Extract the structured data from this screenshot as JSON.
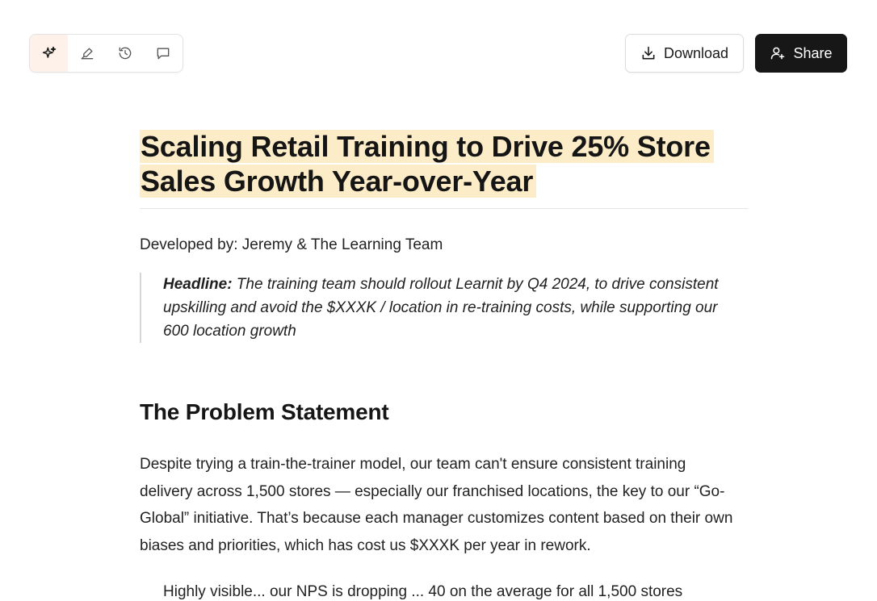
{
  "toolbar": {
    "tools": [
      "sparkles-icon",
      "highlighter-icon",
      "history-icon",
      "comment-icon"
    ],
    "active_color": "#fdf1ea"
  },
  "actions": {
    "download_label": "Download",
    "share_label": "Share"
  },
  "document": {
    "title_line1": "Scaling Retail Training to Drive 25% Store",
    "title_line2": "Sales Growth Year-over-Year",
    "byline": "Developed by: Jeremy & The Learning Team",
    "headline_label": "Headline:",
    "headline_text": " The training team should rollout Learnit by Q4 2024, to drive consistent upskilling and avoid the $XXXK / location in re-training costs, while supporting our 600 location growth",
    "section_heading": "The Problem Statement",
    "paragraph": "Despite trying a train-the-trainer model, our team can't ensure consistent training delivery across 1,500 stores — especially our franchised locations, the key to our “Go-Global” initiative. That’s because each manager customizes content based on their own biases and priorities, which has cost us $XXXK per year in rework.",
    "bullet_partial": "Highly visible... our NPS is dropping ... 40 on the average for all 1,500 stores"
  },
  "colors": {
    "title_highlight": "#fdecc8",
    "share_bg": "#171717"
  }
}
